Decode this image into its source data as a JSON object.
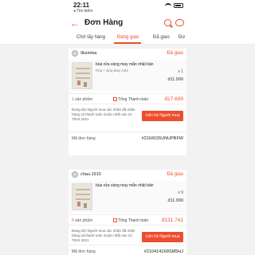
{
  "status_bar": {
    "time": "22:11",
    "back_app": "◂ Tìm kiếm"
  },
  "header": {
    "title": "Đơn Hàng"
  },
  "tabs": [
    {
      "label": "Chờ lấy hàng",
      "active": false
    },
    {
      "label": "Đang giao",
      "active": true
    },
    {
      "label": "Đã giao",
      "active": false
    },
    {
      "label": "Đơ",
      "active": false
    }
  ],
  "orders": [
    {
      "shop_name": "9ksimba",
      "status": "Đã giao",
      "product": {
        "name": "bùa rửa vàng may mắn nhật bản",
        "variant": "Rùa + Bùa,May mắn",
        "qty": "x 1",
        "price": "đ11.999"
      },
      "item_count_num": "1",
      "item_count_label": "sản phẩm",
      "total_label": "Tổng Thanh toán:",
      "total_value": "đ17.699",
      "info": "Đang đợi Người mua xác nhận đã nhận hàng và thanh toán muộn nhất vào 24 Th04 2021",
      "button": "Liên hệ Người mua",
      "code_label": "Mã đơn hàng",
      "code_value": "#2104155UNUPBFW"
    },
    {
      "shop_name": "chau.1910",
      "status": "Đã giao",
      "product": {
        "name": "bùa rửa vàng may mắn nhật bản",
        "variant": "",
        "qty": "x 9",
        "price": "đ11.999"
      },
      "item_count_num": "9",
      "item_count_label": "sản phẩm",
      "total_label": "Tổng Thanh toán:",
      "total_value": "đ131.741",
      "info": "Đang đợi Người mua xác nhận đã nhận hàng và thanh toán muộn nhất vào 22 Th04 2021",
      "button": "Liên hệ Người mua",
      "code_label": "Mã đơn hàng",
      "code_value": "#2104141K8SM5HJ"
    }
  ]
}
